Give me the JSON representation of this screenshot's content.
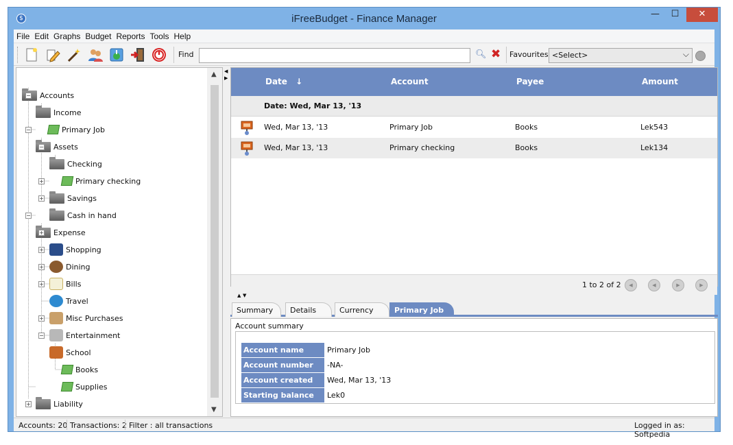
{
  "window": {
    "title": "iFreeBudget - Finance Manager",
    "min": "—",
    "max": "☐",
    "close": "✕"
  },
  "menu": [
    "File",
    "Edit",
    "Graphs",
    "Budget",
    "Reports",
    "Tools",
    "Help"
  ],
  "toolbar": {
    "find_label": "Find",
    "find_value": "",
    "favourites_label": "Favourites",
    "favourites_selected": "<Select>"
  },
  "tree": {
    "root": "Accounts",
    "income": "Income",
    "primary_job": "Primary Job",
    "assets": "Assets",
    "checking": "Checking",
    "primary_checking": "Primary checking",
    "savings": "Savings",
    "cash_in_hand": "Cash in hand",
    "expense": "Expense",
    "shopping": "Shopping",
    "dining": "Dining",
    "bills": "Bills",
    "travel": "Travel",
    "misc_purchases": "Misc Purchases",
    "entertainment": "Entertainment",
    "school": "School",
    "books": "Books",
    "supplies": "Supplies",
    "liability": "Liability"
  },
  "table": {
    "columns": {
      "date": "Date",
      "account": "Account",
      "payee": "Payee",
      "amount": "Amount"
    },
    "sort_indicator": "↓",
    "group_label": "Date: Wed, Mar 13, '13",
    "rows": [
      {
        "date": "Wed, Mar 13, '13",
        "account": "Primary Job",
        "payee": "Books",
        "amount": "Lek543"
      },
      {
        "date": "Wed, Mar 13, '13",
        "account": "Primary checking",
        "payee": "Books",
        "amount": "Lek134"
      }
    ],
    "pager_text": "1 to 2 of 2"
  },
  "tabs": [
    "Summary",
    "Details",
    "Currency",
    "Primary Job"
  ],
  "detail": {
    "title": "Account summary",
    "rows": [
      {
        "key": "Account name",
        "value": "Primary Job"
      },
      {
        "key": "Account number",
        "value": "-NA-"
      },
      {
        "key": "Account created on",
        "value": "Wed, Mar 13, '13"
      },
      {
        "key": "Starting balance",
        "value": "Lek0"
      }
    ]
  },
  "status": {
    "accounts": "Accounts: 20",
    "transactions": "Transactions: 2",
    "filter": "Filter : all transactions",
    "logged_in": "Logged in as: Softpedia"
  }
}
